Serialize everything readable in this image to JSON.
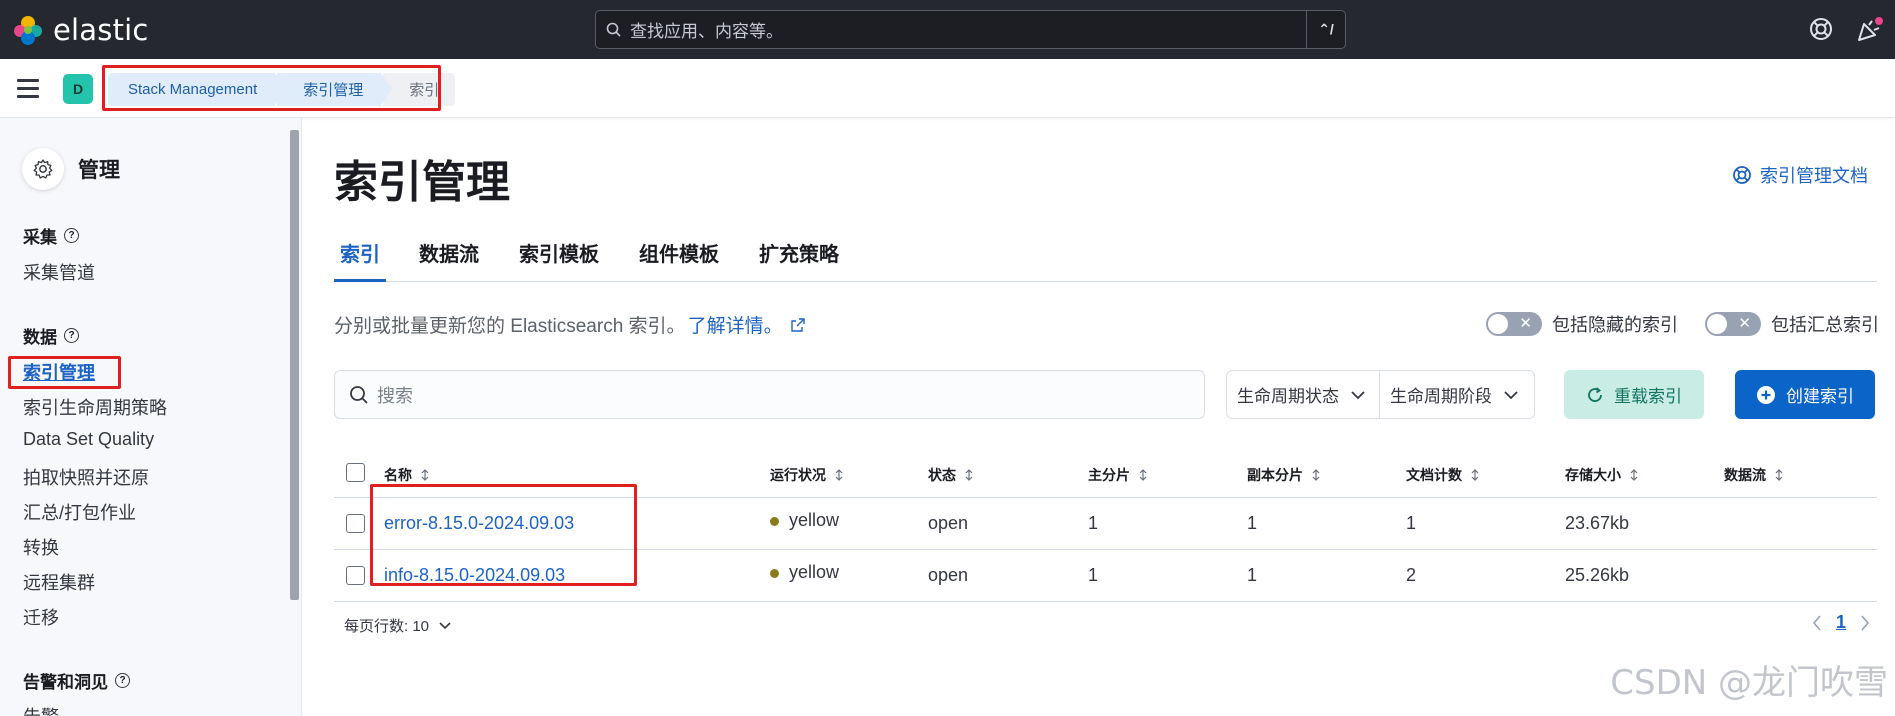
{
  "header": {
    "logo_text": "elastic",
    "search_placeholder": "查找应用、内容等。",
    "search_shortcut": "⌃/"
  },
  "breadcrumbs": [
    "Stack Management",
    "索引管理",
    "索引"
  ],
  "space_avatar": "D",
  "sidebar": {
    "title": "管理",
    "groups": [
      {
        "label": "采集",
        "items": [
          "采集管道"
        ]
      },
      {
        "label": "数据",
        "items": [
          "索引管理",
          "索引生命周期策略",
          "Data Set Quality",
          "拍取快照并还原",
          "汇总/打包作业",
          "转换",
          "远程集群",
          "迁移"
        ]
      },
      {
        "label": "告警和洞见",
        "items": [
          "告警"
        ]
      }
    ],
    "active_item": "索引管理"
  },
  "main": {
    "title": "索引管理",
    "doc_link": "索引管理文档",
    "tabs": [
      "索引",
      "数据流",
      "索引模板",
      "组件模板",
      "扩充策略"
    ],
    "active_tab": "索引",
    "description": "分别或批量更新您的 Elasticsearch 索引。",
    "learn_more": "了解详情。",
    "toggles": [
      {
        "label": "包括隐藏的索引",
        "on": false
      },
      {
        "label": "包括汇总索引",
        "on": false
      }
    ],
    "search_placeholder": "搜索",
    "filters": [
      "生命周期状态",
      "生命周期阶段"
    ],
    "reload_button": "重载索引",
    "create_button": "创建索引",
    "table": {
      "columns": [
        "名称",
        "运行状况",
        "状态",
        "主分片",
        "副本分片",
        "文档计数",
        "存储大小",
        "数据流"
      ],
      "rows": [
        {
          "name": "error-8.15.0-2024.09.03",
          "health": "yellow",
          "status": "open",
          "primary": "1",
          "replicas": "1",
          "docs": "1",
          "size": "23.67kb",
          "stream": ""
        },
        {
          "name": "info-8.15.0-2024.09.03",
          "health": "yellow",
          "status": "open",
          "primary": "1",
          "replicas": "1",
          "docs": "2",
          "size": "25.26kb",
          "stream": ""
        }
      ]
    },
    "rows_per_page": "每页行数: 10",
    "current_page": "1"
  },
  "watermark": "CSDN @龙门吹雪",
  "colors": {
    "accent": "#1d63c4",
    "annotation_red": "#e0201f",
    "health_yellow": "#8a7a1a"
  }
}
